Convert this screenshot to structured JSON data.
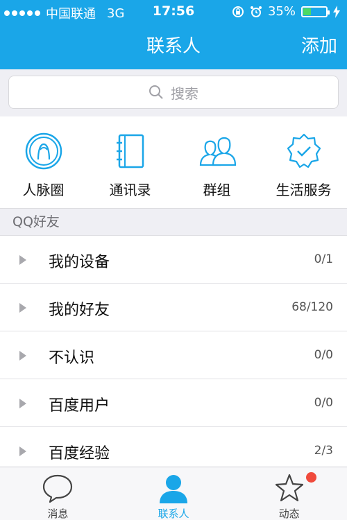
{
  "colors": {
    "accent": "#1aa6e8",
    "badge": "#f04a3c",
    "battery": "#4cd964"
  },
  "status_bar": {
    "carrier": "中国联通",
    "network": "3G",
    "time": "17:56",
    "battery_text": "35%",
    "battery_level": 0.35
  },
  "nav": {
    "title": "联系人",
    "add_label": "添加"
  },
  "search": {
    "placeholder": "搜索"
  },
  "quick_actions": [
    {
      "label": "人脉圈",
      "icon": "person-circle-icon"
    },
    {
      "label": "通讯录",
      "icon": "address-book-icon"
    },
    {
      "label": "群组",
      "icon": "group-icon"
    },
    {
      "label": "生活服务",
      "icon": "badge-check-icon"
    }
  ],
  "section": {
    "title": "QQ好友"
  },
  "groups": [
    {
      "name": "我的设备",
      "count": "0/1"
    },
    {
      "name": "我的好友",
      "count": "68/120"
    },
    {
      "name": "不认识",
      "count": "0/0"
    },
    {
      "name": "百度用户",
      "count": "0/0"
    },
    {
      "name": "百度经验",
      "count": "2/3"
    }
  ],
  "tabs": [
    {
      "label": "消息",
      "icon": "chat-bubble-icon",
      "active": false
    },
    {
      "label": "联系人",
      "icon": "person-icon",
      "active": true
    },
    {
      "label": "动态",
      "icon": "star-icon",
      "active": false
    }
  ]
}
